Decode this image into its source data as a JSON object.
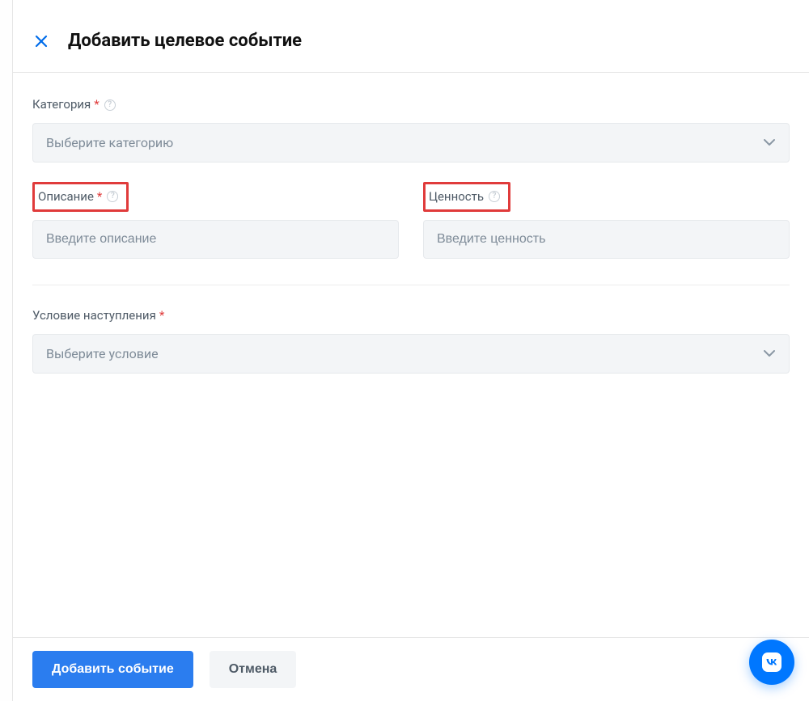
{
  "header": {
    "title": "Добавить целевое событие"
  },
  "category": {
    "label": "Категория",
    "required_mark": "*",
    "placeholder": "Выберите категорию"
  },
  "description": {
    "label": "Описание",
    "required_mark": "*",
    "placeholder": "Введите описание"
  },
  "value": {
    "label": "Ценность",
    "placeholder": "Введите ценность"
  },
  "condition": {
    "label": "Условие наступления",
    "required_mark": "*",
    "placeholder": "Выберите условие"
  },
  "footer": {
    "submit_label": "Добавить событие",
    "cancel_label": "Отмена"
  },
  "icons": {
    "help_glyph": "?"
  }
}
